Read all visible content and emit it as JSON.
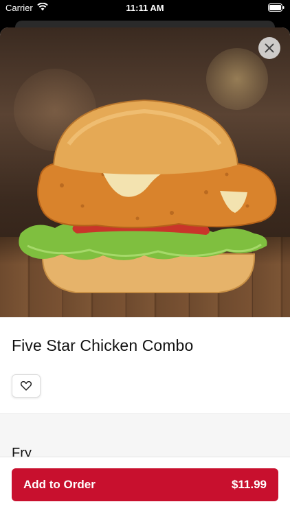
{
  "status_bar": {
    "carrier": "Carrier",
    "time": "11:11 AM"
  },
  "product": {
    "name": "Five Star Chicken Combo",
    "image_icon": "chicken-sandwich-photo"
  },
  "sections": [
    {
      "title": "Fry"
    }
  ],
  "order_button": {
    "label": "Add to Order",
    "price": "$11.99"
  },
  "colors": {
    "accent": "#c8102e",
    "section_bg": "#f6f6f6"
  }
}
